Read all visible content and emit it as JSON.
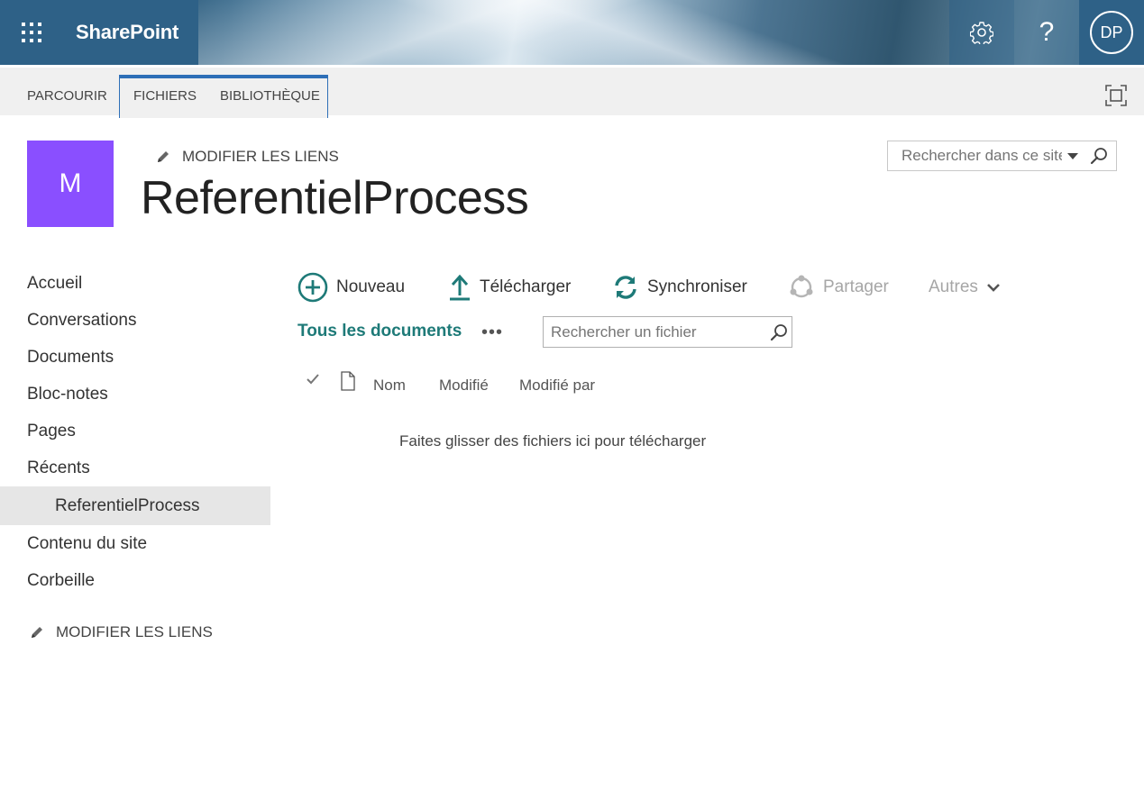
{
  "suite_bar": {
    "brand": "SharePoint",
    "help_glyph": "?",
    "user_initials": "DP",
    "icons": [
      "waffle-icon",
      "gear-icon",
      "help-icon"
    ]
  },
  "ribbon": {
    "tabs": [
      {
        "label": "PARCOURIR"
      },
      {
        "label": "FICHIERS"
      },
      {
        "label": "BIBLIOTHÈQUE"
      }
    ],
    "focus_icon": "focus-on-content-icon"
  },
  "header": {
    "logo_letter": "M",
    "edit_links": "MODIFIER LES LIENS",
    "site_title": "ReferentielProcess",
    "search_placeholder": "Rechercher dans ce site"
  },
  "leftnav": {
    "items": [
      {
        "label": "Accueil"
      },
      {
        "label": "Conversations"
      },
      {
        "label": "Documents"
      },
      {
        "label": "Bloc-notes"
      },
      {
        "label": "Pages"
      },
      {
        "label": "Récents"
      },
      {
        "label": "ReferentielProcess"
      },
      {
        "label": "Contenu du site"
      },
      {
        "label": "Corbeille"
      }
    ],
    "edit_links": "MODIFIER LES LIENS"
  },
  "commands": {
    "new": "Nouveau",
    "upload": "Télécharger",
    "sync": "Synchroniser",
    "share": "Partager",
    "more": "Autres"
  },
  "view": {
    "label": "Tous les documents",
    "dots": "•••",
    "search_placeholder": "Rechercher un fichier"
  },
  "columns": {
    "name": "Nom",
    "modified": "Modifié",
    "modified_by": "Modifié par"
  },
  "drop_hint": "Faites glisser des fichiers ici pour télécharger",
  "colors": {
    "brand_blue": "#2e6187",
    "accent_teal": "#1e7a78",
    "logo_purple": "#8a4fff",
    "ribbon_border": "#2e6fb7"
  }
}
